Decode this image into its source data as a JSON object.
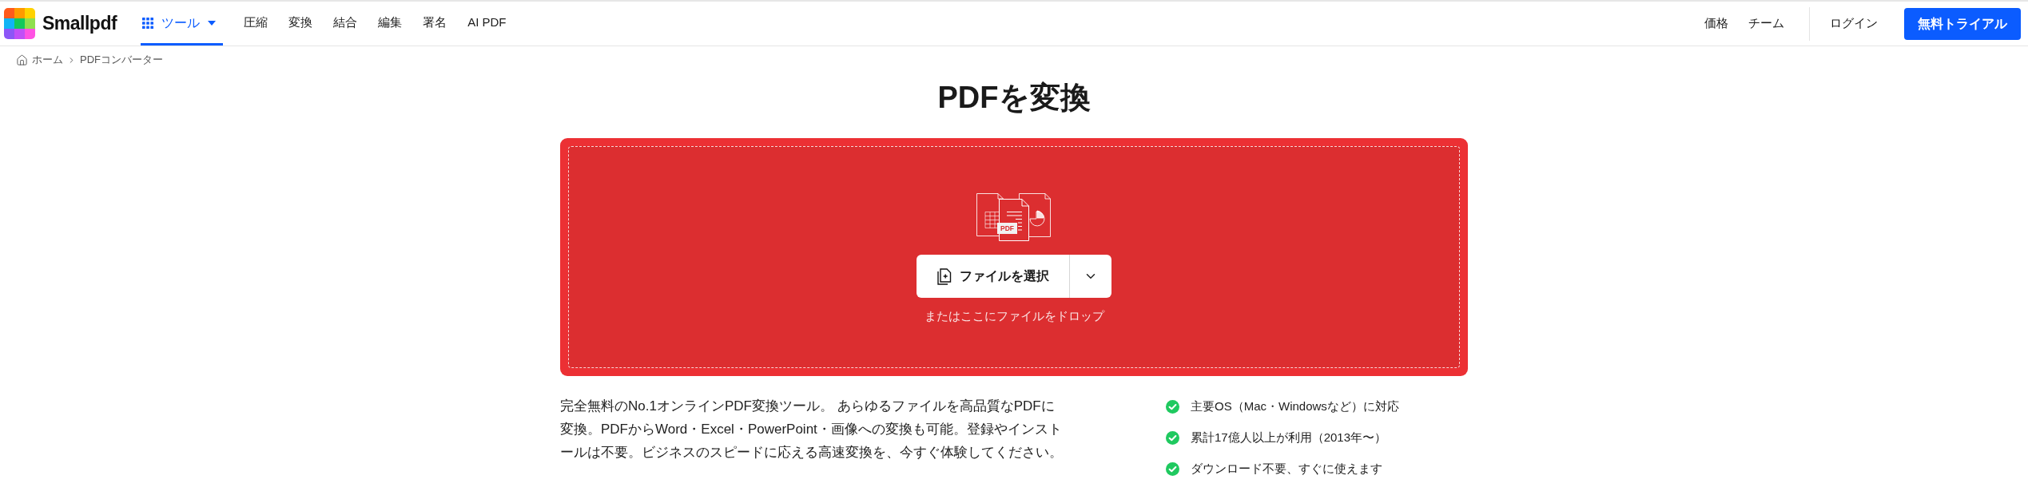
{
  "header": {
    "logo": {
      "name": "Smallpdf"
    },
    "nav": [
      {
        "kind": "menu",
        "label": "ツール",
        "selected": true
      },
      {
        "kind": "link",
        "label": "圧縮",
        "selected": false
      },
      {
        "kind": "link",
        "label": "変換",
        "selected": false
      },
      {
        "kind": "link",
        "label": "結合",
        "selected": false
      },
      {
        "kind": "link",
        "label": "編集",
        "selected": false
      },
      {
        "kind": "link",
        "label": "署名",
        "selected": false
      },
      {
        "kind": "link",
        "label": "AI PDF",
        "selected": false
      }
    ],
    "right_links": [
      "価格",
      "チーム"
    ],
    "login": "ログイン",
    "cta_button": "無料トライアル"
  },
  "breadcrumb": [
    "ホーム",
    "PDFコンバーター"
  ],
  "title": "PDFを変換",
  "dropzone": {
    "illustration_label": "PDF",
    "select_button": "ファイルを選択",
    "drop_hint": "またはここにファイルをドロップ"
  },
  "description": "完全無料のNo.1オンラインPDF変換ツール。 あらゆるファイルを高品質なPDFに変換。PDFからWord・Excel・PowerPoint・画像への変換も可能。登録やインストールは不要。ビジネスのスピードに応える高速変換を、今すぐ体験してください。",
  "features": [
    "主要OS（Mac・Windowsなど）に対応",
    "累計17億人以上が利用（2013年〜）",
    "ダウンロード不要、すぐに使えます"
  ]
}
